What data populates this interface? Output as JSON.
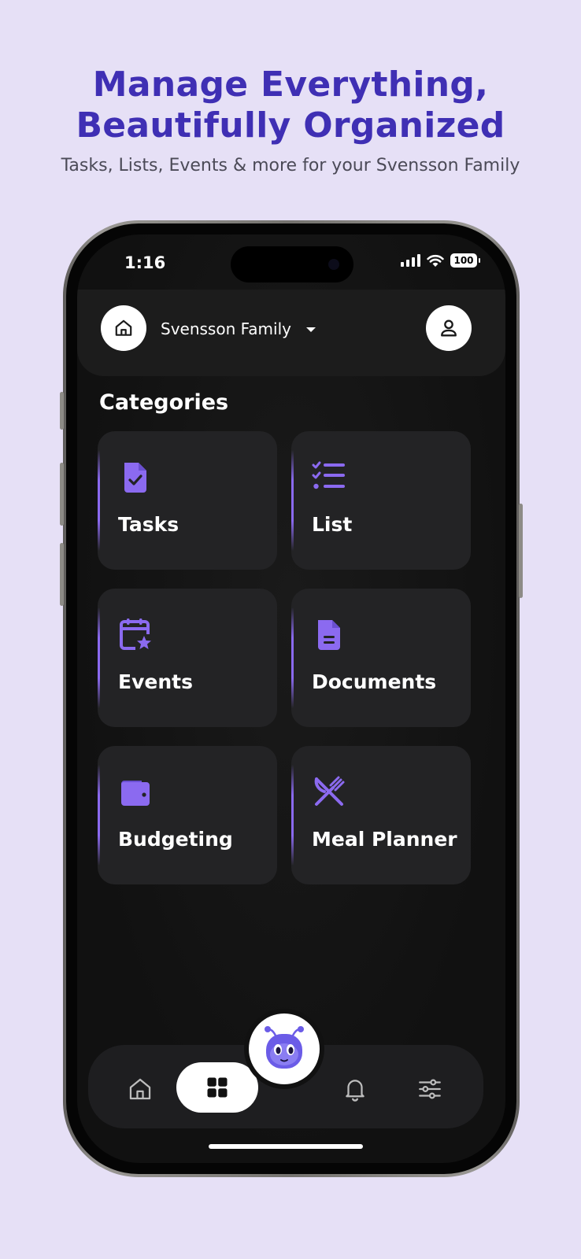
{
  "promo": {
    "headline_line1": "Manage Everything,",
    "headline_line2": "Beautifully Organized",
    "subheadline": "Tasks, Lists, Events & more for your Svensson Family"
  },
  "status_bar": {
    "time": "1:16",
    "battery": "100"
  },
  "header": {
    "family_name": "Svensson Family"
  },
  "categories": {
    "title": "Categories",
    "items": [
      {
        "label": "Tasks",
        "icon": "file-check-icon"
      },
      {
        "label": "List",
        "icon": "checklist-icon"
      },
      {
        "label": "Events",
        "icon": "calendar-star-icon"
      },
      {
        "label": "Documents",
        "icon": "document-icon"
      },
      {
        "label": "Budgeting",
        "icon": "wallet-icon"
      },
      {
        "label": "Meal Planner",
        "icon": "fork-knife-icon"
      }
    ]
  },
  "bottom_nav": {
    "items": [
      "home-icon",
      "grid-icon",
      "mascot-icon",
      "bell-icon",
      "sliders-icon"
    ],
    "active": "grid-icon"
  },
  "colors": {
    "accent": "#8b6af0",
    "headline": "#3f2fb4",
    "background": "#e6e0f6",
    "card": "#232325"
  }
}
